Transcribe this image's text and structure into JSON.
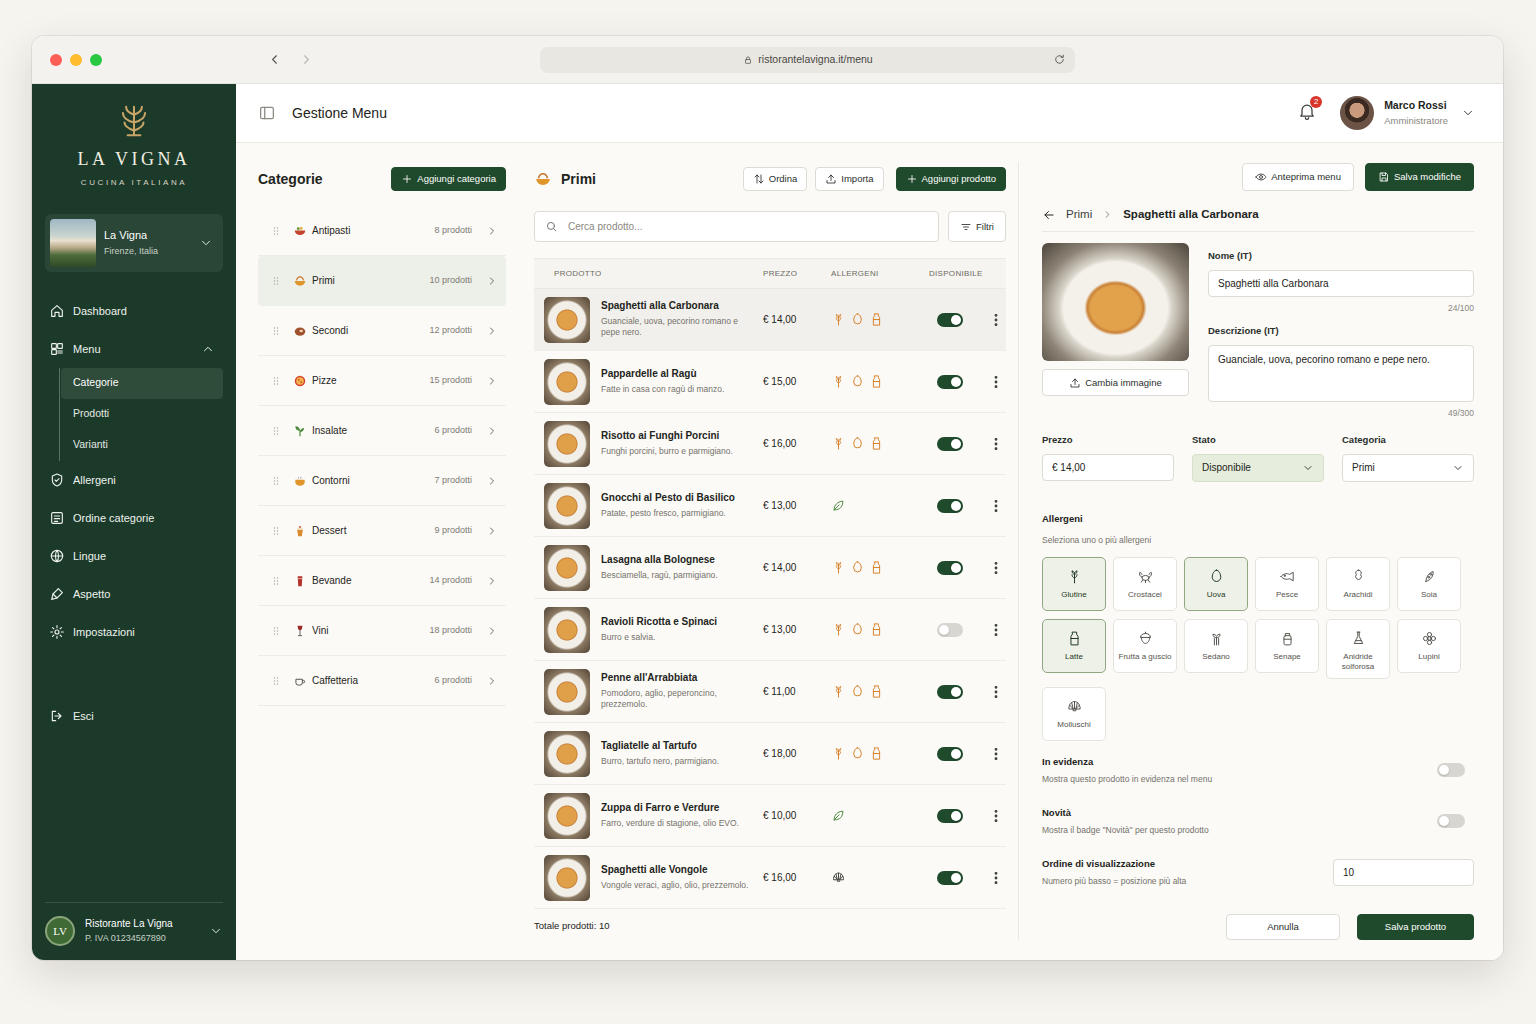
{
  "browser": {
    "url": "ristorantelavigna.it/menu"
  },
  "brand": {
    "name": "LA VIGNA",
    "tagline": "CUCINA ITALIANA"
  },
  "venue": {
    "name": "La Vigna",
    "location": "Firenze, Italia"
  },
  "sidebar": {
    "items": [
      {
        "label": "Dashboard",
        "selected": false
      },
      {
        "label": "Menu",
        "selected": false,
        "expanded": true,
        "children": [
          {
            "label": "Categorie",
            "selected": true
          },
          {
            "label": "Prodotti",
            "selected": false
          },
          {
            "label": "Varianti",
            "selected": false
          }
        ]
      },
      {
        "label": "Allergeni",
        "selected": false
      },
      {
        "label": "Ordine categorie",
        "selected": false
      },
      {
        "label": "Lingue",
        "selected": false
      },
      {
        "label": "Aspetto",
        "selected": false
      },
      {
        "label": "Impostazioni",
        "selected": false
      }
    ],
    "logout": "Esci"
  },
  "account": {
    "initials": "LV",
    "name": "Ristorante La Vigna",
    "vat": "P. IVA 01234567890"
  },
  "header": {
    "title": "Gestione Menu",
    "notifications": "2",
    "user": {
      "name": "Marco Rossi",
      "role": "Amministratore"
    }
  },
  "categories": {
    "title": "Categorie",
    "add": "Aggiungi categoria",
    "items": [
      {
        "name": "Antipasti",
        "count": "8 prodotti",
        "selected": false
      },
      {
        "name": "Primi",
        "count": "10 prodotti",
        "selected": true
      },
      {
        "name": "Secondi",
        "count": "12 prodotti",
        "selected": false
      },
      {
        "name": "Pizze",
        "count": "15 prodotti",
        "selected": false
      },
      {
        "name": "Insalate",
        "count": "6 prodotti",
        "selected": false
      },
      {
        "name": "Contorni",
        "count": "7 prodotti",
        "selected": false
      },
      {
        "name": "Dessert",
        "count": "9 prodotti",
        "selected": false
      },
      {
        "name": "Bevande",
        "count": "14 prodotti",
        "selected": false
      },
      {
        "name": "Vini",
        "count": "18 prodotti",
        "selected": false
      },
      {
        "name": "Caffetteria",
        "count": "6 prodotti",
        "selected": false
      }
    ]
  },
  "products": {
    "title": "Primi",
    "sort": "Ordina",
    "import": "Importa",
    "add": "Aggiungi prodotto",
    "search_placeholder": "Cerca prodotto...",
    "filters": "Filtri",
    "columns": [
      "PRODOTTO",
      "PREZZO",
      "ALLERGENI",
      "DISPONIBILE"
    ],
    "rows": [
      {
        "name": "Spaghetti alla Carbonara",
        "description": "Guanciale, uova, pecorino romano e pepe nero.",
        "price": "€ 14,00",
        "allergens": [
          {
            "kind": "glutine"
          },
          {
            "kind": "uova"
          },
          {
            "kind": "latte"
          }
        ],
        "available": true,
        "selected": true
      },
      {
        "name": "Pappardelle al Ragù",
        "description": "Fatte in casa con ragù di manzo.",
        "price": "€ 15,00",
        "allergens": [
          {
            "kind": "glutine"
          },
          {
            "kind": "uova"
          },
          {
            "kind": "latte"
          }
        ],
        "available": true,
        "selected": false
      },
      {
        "name": "Risotto ai Funghi Porcini",
        "description": "Funghi porcini, burro e parmigiano.",
        "price": "€ 16,00",
        "allergens": [
          {
            "kind": "glutine"
          },
          {
            "kind": "uova"
          },
          {
            "kind": "latte"
          }
        ],
        "available": true,
        "selected": false
      },
      {
        "name": "Gnocchi al Pesto di Basilico",
        "description": "Patate, pesto fresco, parmigiano.",
        "price": "€ 13,00",
        "allergens": [
          {
            "kind": "vegano"
          }
        ],
        "available": true,
        "selected": false
      },
      {
        "name": "Lasagna alla Bolognese",
        "description": "Besciamella, ragù, parmigiano.",
        "price": "€ 14,00",
        "allergens": [
          {
            "kind": "glutine"
          },
          {
            "kind": "uova"
          },
          {
            "kind": "latte"
          }
        ],
        "available": true,
        "selected": false
      },
      {
        "name": "Ravioli Ricotta e Spinaci",
        "description": "Burro e salvia.",
        "price": "€ 13,00",
        "allergens": [
          {
            "kind": "glutine"
          },
          {
            "kind": "uova"
          },
          {
            "kind": "latte"
          }
        ],
        "available": false,
        "selected": false
      },
      {
        "name": "Penne all'Arrabbiata",
        "description": "Pomodoro, aglio, peperoncino, prezzemolo.",
        "price": "€ 11,00",
        "allergens": [
          {
            "kind": "glutine"
          },
          {
            "kind": "uova"
          },
          {
            "kind": "latte"
          }
        ],
        "available": true,
        "selected": false
      },
      {
        "name": "Tagliatelle al Tartufo",
        "description": "Burro, tartufo nero, parmigiano.",
        "price": "€ 18,00",
        "allergens": [
          {
            "kind": "glutine"
          },
          {
            "kind": "uova"
          },
          {
            "kind": "latte"
          }
        ],
        "available": true,
        "selected": false
      },
      {
        "name": "Zuppa di Farro e Verdure",
        "description": "Farro, verdure di stagione, olio EVO.",
        "price": "€ 10,00",
        "allergens": [
          {
            "kind": "vegano"
          }
        ],
        "available": true,
        "selected": false
      },
      {
        "name": "Spaghetti alle Vongole",
        "description": "Vongole veraci, aglio, olio, prezzemolo.",
        "price": "€ 16,00",
        "allergens": [
          {
            "kind": "molluschi"
          }
        ],
        "available": true,
        "selected": false
      }
    ],
    "total": "Totale prodotti: 10"
  },
  "editor": {
    "preview": "Anteprima menu",
    "save": "Salva modifiche",
    "breadcrumb": [
      "Primi",
      "Spaghetti alla Carbonara"
    ],
    "change_image": "Cambia immagine",
    "name": {
      "label": "Nome (IT)",
      "value": "Spaghetti alla Carbonara",
      "counter": "24/100"
    },
    "description": {
      "label": "Descrizione (IT)",
      "value": "Guanciale, uova, pecorino romano e pepe nero.",
      "counter": "49/300"
    },
    "price": {
      "label": "Prezzo",
      "value": "€ 14,00"
    },
    "status": {
      "label": "Stato",
      "value": "Disponibile"
    },
    "category": {
      "label": "Categoria",
      "value": "Primi"
    },
    "allergens": {
      "title": "Allergeni",
      "hint": "Seleziona uno o più allergeni",
      "items": [
        {
          "label": "Glutine",
          "selected": true
        },
        {
          "label": "Crostacei",
          "selected": false
        },
        {
          "label": "Uova",
          "selected": true
        },
        {
          "label": "Pesce",
          "selected": false
        },
        {
          "label": "Arachidi",
          "selected": false
        },
        {
          "label": "Soia",
          "selected": false
        },
        {
          "label": "Latte",
          "selected": true
        },
        {
          "label": "Frutta a guscio",
          "selected": false
        },
        {
          "label": "Sedano",
          "selected": false
        },
        {
          "label": "Senape",
          "selected": false
        },
        {
          "label": "Anidride solforosa",
          "selected": false
        },
        {
          "label": "Lupini",
          "selected": false
        },
        {
          "label": "Molluschi",
          "selected": false
        }
      ]
    },
    "switches": [
      {
        "title": "In evidenza",
        "description": "Mostra questo prodotto in evidenza nel menu",
        "on": false
      },
      {
        "title": "Novità",
        "description": "Mostra il badge \"Novità\" per questo prodotto",
        "on": false
      }
    ],
    "order": {
      "title": "Ordine di visualizzazione",
      "description": "Numero più basso = posizione più alta",
      "value": "10"
    },
    "cancel": "Annulla",
    "save_product": "Salva prodotto"
  }
}
